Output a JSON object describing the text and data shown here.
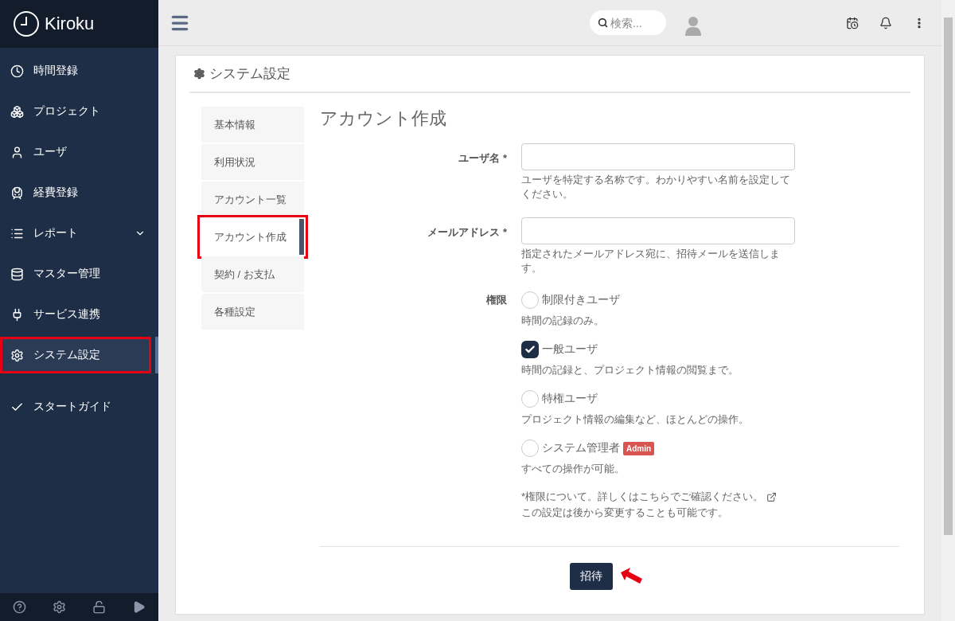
{
  "app": {
    "name": "Kiroku"
  },
  "sidebar": {
    "items": [
      {
        "label": "時間登録",
        "selected": false
      },
      {
        "label": "プロジェクト",
        "selected": false
      },
      {
        "label": "ユーザ",
        "selected": false
      },
      {
        "label": "経費登録",
        "selected": false
      },
      {
        "label": "レポート",
        "selected": false,
        "expandable": true
      },
      {
        "label": "マスター管理",
        "selected": false
      },
      {
        "label": "サービス連携",
        "selected": false
      },
      {
        "label": "システム設定",
        "selected": true
      },
      {
        "label": "スタートガイド",
        "selected": false
      }
    ]
  },
  "topbar": {
    "search": {
      "placeholder": "検索..."
    }
  },
  "page": {
    "title": "システム設定"
  },
  "subnav": {
    "items": [
      {
        "label": "基本情報",
        "selected": false
      },
      {
        "label": "利用状況",
        "selected": false
      },
      {
        "label": "アカウント一覧",
        "selected": false
      },
      {
        "label": "アカウント作成",
        "selected": true
      },
      {
        "label": "契約 / お支払",
        "selected": false
      },
      {
        "label": "各種設定",
        "selected": false
      }
    ]
  },
  "form": {
    "title": "アカウント作成",
    "fields": [
      {
        "label": "ユーザ名 *",
        "description": "ユーザを特定する名称です。わかりやすい名前を設定してください。"
      },
      {
        "label": "メールアドレス *",
        "description": "指定されたメールアドレス宛に、招待メールを送信します。"
      }
    ],
    "permission": {
      "label": "権限",
      "options": [
        {
          "label": "制限付きユーザ",
          "description": "時間の記録のみ。",
          "selected": false
        },
        {
          "label": "一般ユーザ",
          "description": "時間の記録と、プロジェクト情報の閲覧まで。",
          "selected": true
        },
        {
          "label": "特権ユーザ",
          "description": "プロジェクト情報の編集など、ほとんどの操作。",
          "selected": false
        },
        {
          "label": "システム管理者",
          "badge": "Admin",
          "description": "すべての操作が可能。",
          "selected": false
        }
      ],
      "notes": [
        "*権限について。詳しくはこちらでご確認ください。",
        "この設定は後から変更することも可能です。"
      ]
    },
    "submit": "招待"
  }
}
